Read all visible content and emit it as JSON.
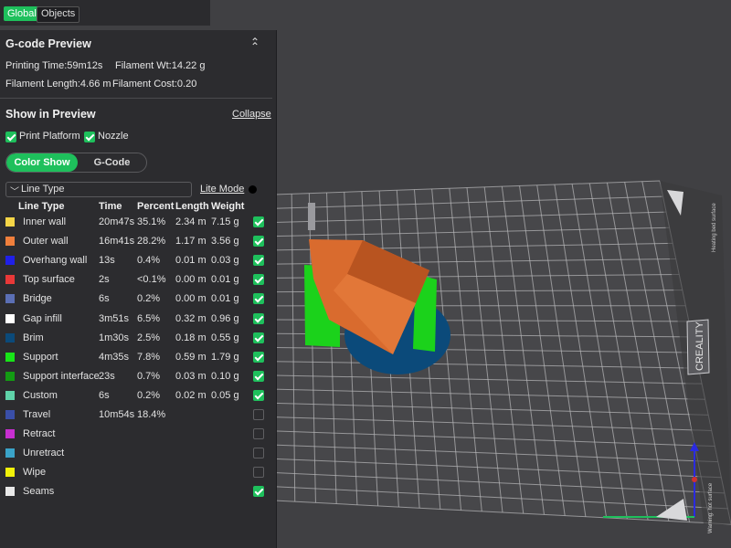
{
  "tabs": {
    "global": "Global",
    "objects": "Objects"
  },
  "gcode_preview": {
    "title": "G-code Preview",
    "printing_time": "Printing Time:59m12s",
    "filament_weight": "Filament Wt:14.22 g",
    "filament_length": "Filament Length:4.66 m",
    "filament_cost": "Filament Cost:0.20",
    "collapse_icon": "double-chevron-up-icon"
  },
  "show_in_preview": {
    "title": "Show in Preview",
    "collapse_label": "Collapse",
    "print_platform": {
      "label": "Print Platform",
      "checked": true
    },
    "nozzle": {
      "label": "Nozzle",
      "checked": true
    },
    "modes": [
      "Color Show",
      "G-Code"
    ],
    "active_mode": "Color Show",
    "dropdown_value": "Line Type",
    "lite_mode_label": "Lite Mode"
  },
  "table": {
    "headers": [
      "Line Type",
      "Time",
      "Percent",
      "Length",
      "Weight"
    ],
    "rows": [
      {
        "name": "Inner wall",
        "color": "#f5d547",
        "time": "20m47s",
        "percent": "35.1%",
        "length": "2.34 m",
        "weight": "7.15 g",
        "checked": true
      },
      {
        "name": "Outer wall",
        "color": "#f07f3c",
        "time": "16m41s",
        "percent": "28.2%",
        "length": "1.17 m",
        "weight": "3.56 g",
        "checked": true
      },
      {
        "name": "Overhang wall",
        "color": "#2020e8",
        "time": "13s",
        "percent": "0.4%",
        "length": "0.01 m",
        "weight": "0.03 g",
        "checked": true
      },
      {
        "name": "Top surface",
        "color": "#e83838",
        "time": "2s",
        "percent": "<0.1%",
        "length": "0.00 m",
        "weight": "0.01 g",
        "checked": true
      },
      {
        "name": "Bridge",
        "color": "#5b6fb5",
        "time": "6s",
        "percent": "0.2%",
        "length": "0.00 m",
        "weight": "0.01 g",
        "checked": true
      },
      {
        "name": "Gap infill",
        "color": "#ffffff",
        "time": "3m51s",
        "percent": "6.5%",
        "length": "0.32 m",
        "weight": "0.96 g",
        "checked": true
      },
      {
        "name": "Brim",
        "color": "#0b4a7a",
        "time": "1m30s",
        "percent": "2.5%",
        "length": "0.18 m",
        "weight": "0.55 g",
        "checked": true
      },
      {
        "name": "Support",
        "color": "#18e418",
        "time": "4m35s",
        "percent": "7.8%",
        "length": "0.59 m",
        "weight": "1.79 g",
        "checked": true
      },
      {
        "name": "Support interface",
        "color": "#139b13",
        "time": "23s",
        "percent": "0.7%",
        "length": "0.03 m",
        "weight": "0.10 g",
        "checked": true
      },
      {
        "name": "Custom",
        "color": "#5fd3a9",
        "time": "6s",
        "percent": "0.2%",
        "length": "0.02 m",
        "weight": "0.05 g",
        "checked": true
      },
      {
        "name": "Travel",
        "color": "#3a4fa8",
        "time": "10m54s",
        "percent": "18.4%",
        "length": "",
        "weight": "",
        "checked": false
      },
      {
        "name": "Retract",
        "color": "#c72fd0",
        "time": "",
        "percent": "",
        "length": "",
        "weight": "",
        "checked": false
      },
      {
        "name": "Unretract",
        "color": "#3aa3c8",
        "time": "",
        "percent": "",
        "length": "",
        "weight": "",
        "checked": false
      },
      {
        "name": "Wipe",
        "color": "#f2f20a",
        "time": "",
        "percent": "",
        "length": "",
        "weight": "",
        "checked": false
      },
      {
        "name": "Seams",
        "color": "#e8e8e8",
        "time": "",
        "percent": "",
        "length": "",
        "weight": "",
        "checked": true
      }
    ]
  },
  "bed": {
    "logo_text": "CREALITY",
    "side_text": "Warning: hot surface",
    "top_right_text": "Heating bed surface"
  },
  "colors": {
    "accent": "#1ec05c"
  }
}
